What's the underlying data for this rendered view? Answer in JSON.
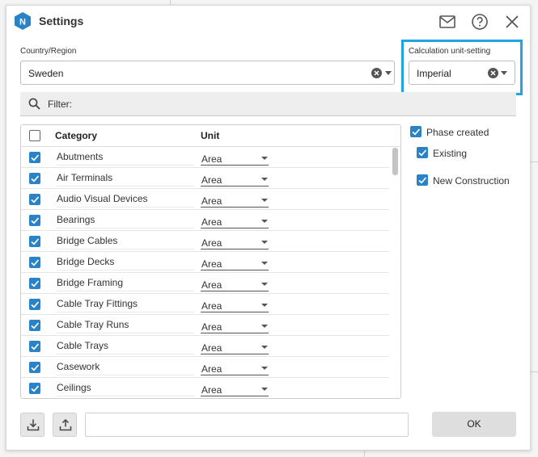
{
  "window": {
    "title": "Settings"
  },
  "toolbar_icons": [
    "mail-icon",
    "help-icon",
    "close-icon"
  ],
  "country": {
    "label": "Country/Region",
    "value": "Sweden"
  },
  "units": {
    "label": "Calculation unit-setting",
    "value": "Imperial"
  },
  "filter": {
    "label": "Filter:"
  },
  "table": {
    "headers": {
      "category": "Category",
      "unit": "Unit"
    },
    "rows": [
      {
        "category": "Abutments",
        "unit": "Area",
        "checked": true
      },
      {
        "category": "Air Terminals",
        "unit": "Area",
        "checked": true
      },
      {
        "category": "Audio Visual Devices",
        "unit": "Area",
        "checked": true
      },
      {
        "category": "Bearings",
        "unit": "Area",
        "checked": true
      },
      {
        "category": "Bridge Cables",
        "unit": "Area",
        "checked": true
      },
      {
        "category": "Bridge Decks",
        "unit": "Area",
        "checked": true
      },
      {
        "category": "Bridge Framing",
        "unit": "Area",
        "checked": true
      },
      {
        "category": "Cable Tray Fittings",
        "unit": "Area",
        "checked": true
      },
      {
        "category": "Cable Tray Runs",
        "unit": "Area",
        "checked": true
      },
      {
        "category": "Cable Trays",
        "unit": "Area",
        "checked": true
      },
      {
        "category": "Casework",
        "unit": "Area",
        "checked": true
      },
      {
        "category": "Ceilings",
        "unit": "Area",
        "checked": true
      }
    ]
  },
  "phases": {
    "created": "Phase created",
    "items": [
      {
        "label": "Existing",
        "checked": true
      },
      {
        "label": "New Construction",
        "checked": true
      }
    ]
  },
  "footer": {
    "ok_label": "OK",
    "input_value": ""
  },
  "colors": {
    "accent": "#2a82c7",
    "highlight": "#1ea5e0"
  }
}
